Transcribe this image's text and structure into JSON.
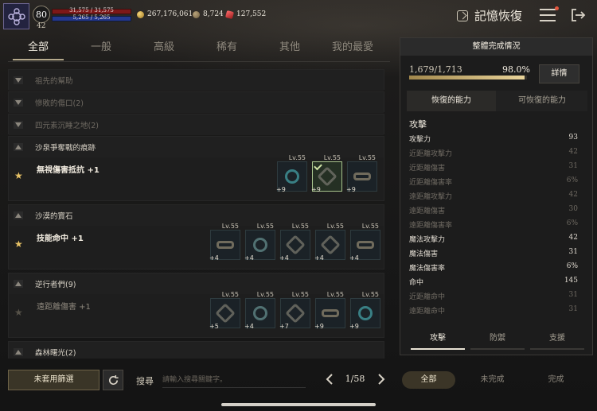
{
  "player": {
    "level": "80",
    "sublevel": "42",
    "hp": "31,575 / 31,575",
    "mp": "5,265 / 5,265"
  },
  "currency": {
    "gold": "267,176,061",
    "silver": "8,724",
    "gem": "127,552"
  },
  "header": {
    "title": "記憶恢復"
  },
  "tabs": [
    "全部",
    "一般",
    "高級",
    "稀有",
    "其他",
    "我的最愛"
  ],
  "groups": [
    {
      "name": "祖先的幫助",
      "stat": ""
    },
    {
      "name": "慘敗的傷口(2)",
      "stat": ""
    },
    {
      "name": "四元素沉睡之地(2)",
      "stat": ""
    },
    {
      "name": "沙泉爭奪戰的痕跡",
      "stat": "無視傷害抵抗 +1",
      "items": [
        {
          "lv": "Lv.55",
          "plus": "+9"
        },
        {
          "lv": "Lv.55",
          "plus": "+9"
        },
        {
          "lv": "Lv.55",
          "plus": "+9"
        }
      ]
    },
    {
      "name": "沙漠的寶石",
      "stat": "技能命中 +1",
      "items": [
        {
          "lv": "Lv.55",
          "plus": "+4"
        },
        {
          "lv": "Lv.55",
          "plus": "+4"
        },
        {
          "lv": "Lv.55",
          "plus": "+4"
        },
        {
          "lv": "Lv.55",
          "plus": "+4"
        },
        {
          "lv": "Lv.55",
          "plus": "+4"
        }
      ]
    },
    {
      "name": "逆行者們(9)",
      "stat": "遠距離傷害 +1",
      "items": [
        {
          "lv": "Lv.55",
          "plus": "+5"
        },
        {
          "lv": "Lv.55",
          "plus": "+4"
        },
        {
          "lv": "Lv.55",
          "plus": "+7"
        },
        {
          "lv": "Lv.55",
          "plus": "+9"
        },
        {
          "lv": "Lv.55",
          "plus": "+9"
        }
      ]
    },
    {
      "name": "森林曙光(2)",
      "stat": ""
    }
  ],
  "panel": {
    "title": "整體完成情況",
    "progress_text": "1,679/1,713",
    "progress_pct": "98.0%",
    "progress_value": 0.98,
    "detail_label": "詳情",
    "tab_left": "恢復的能力",
    "tab_right": "可恢復的能力",
    "category": "攻擊",
    "rows": [
      {
        "name": "攻擊力",
        "value": "93"
      },
      {
        "name": "近距離攻擊力",
        "value": "42"
      },
      {
        "name": "近距離傷害",
        "value": "31"
      },
      {
        "name": "近距離傷害率",
        "value": "6%"
      },
      {
        "name": "遠距離攻擊力",
        "value": "42"
      },
      {
        "name": "遠距離傷害",
        "value": "30"
      },
      {
        "name": "遠距離傷害率",
        "value": "6%"
      },
      {
        "name": "魔法攻擊力",
        "value": "42"
      },
      {
        "name": "魔法傷害",
        "value": "31"
      },
      {
        "name": "魔法傷害率",
        "value": "6%"
      },
      {
        "name": "命中",
        "value": "145"
      },
      {
        "name": "近距離命中",
        "value": "31"
      },
      {
        "name": "遠距離命中",
        "value": "31"
      }
    ],
    "bottom_tabs": [
      "攻擊",
      "防禦",
      "支援"
    ]
  },
  "footer": {
    "unused_filter": "未套用篩選",
    "search_label": "搜尋",
    "search_placeholder": "請輸入搜尋關鍵字。",
    "page": "1/58",
    "filter_tabs": [
      "全部",
      "未完成",
      "完成"
    ]
  }
}
